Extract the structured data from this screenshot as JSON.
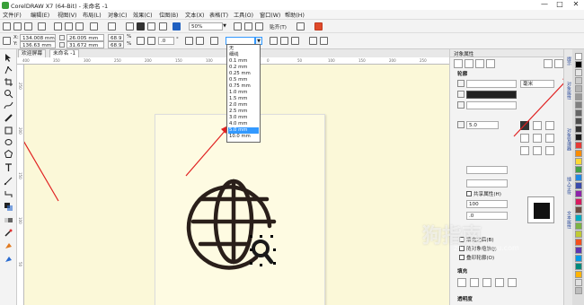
{
  "window": {
    "title": "CorelDRAW X7 (64-Bit) - 未命名 -1",
    "controls": [
      "—",
      "□",
      "✕"
    ]
  },
  "menubar": [
    "文件(F)",
    "编辑(E)",
    "视图(V)",
    "布局(L)",
    "对象(C)",
    "效果(C)",
    "位图(B)",
    "文本(X)",
    "表格(T)",
    "工具(O)",
    "窗口(W)",
    "帮助(H)"
  ],
  "toolbar1": {
    "zoom_value": "50%",
    "snap_label": "贴齐(T)"
  },
  "propertybar": {
    "x_label": "X:",
    "x_value": "134.008 mm",
    "y_label": "Y:",
    "y_value": "136.63 mm",
    "w_value": "26.005 mm",
    "h_value": "31.672 mm",
    "scale_x": "68.9",
    "scale_y": "68.9",
    "pct": "%",
    "rotation": ".0",
    "degree": "°",
    "outline_width": ""
  },
  "tabs": [
    {
      "label": "欢迎屏幕",
      "active": false
    },
    {
      "label": "未命名 -1",
      "active": true
    }
  ],
  "ruler": {
    "h_ticks": [
      "400",
      "350",
      "300",
      "250",
      "200",
      "150",
      "100",
      "50",
      "0",
      "50",
      "100",
      "150",
      "200",
      "250"
    ],
    "v_ticks": [
      "250",
      "200",
      "150",
      "100",
      "50"
    ]
  },
  "outline_dropdown": {
    "options": [
      "无",
      "细线",
      "0.1 mm",
      "0.2 mm",
      "0.25 mm",
      "0.5 mm",
      "0.75 mm",
      "1.0 mm",
      "1.5 mm",
      "2.0 mm",
      "2.5 mm",
      "3.0 mm",
      "4.0 mm",
      "5.0 mm",
      "10.0 mm"
    ],
    "selected": "5.0 mm"
  },
  "panel": {
    "title": "对象属性",
    "section_outline": "轮廓",
    "unit": "毫米",
    "width_value": "5.0",
    "shared_props_label": "共享属性(H)",
    "miter_value": "100",
    "angle_value": ".0",
    "fill_behind": "填充之后(B)",
    "scale_with": "随对象缩放(J)",
    "overprint": "叠印轮廓(O)",
    "section_fill": "填充",
    "section_transparency": "透明度"
  },
  "vertical_tabs": [
    "提示",
    "对象属性",
    "对象管理器",
    "插入字符",
    "文本属性"
  ],
  "palette_colors": [
    "#ffffff",
    "#000000",
    "#e6e6e6",
    "#cccccc",
    "#b3b3b3",
    "#999999",
    "#808080",
    "#666666",
    "#4d4d4d",
    "#333333",
    "#1a1a1a",
    "#e53935",
    "#fb8c00",
    "#fdd835",
    "#43a047",
    "#1e88e5",
    "#3949ab",
    "#8e24aa",
    "#d81b60",
    "#6d4c41",
    "#00acc1",
    "#7cb342",
    "#c0ca33",
    "#f4511e",
    "#5e35b1",
    "#039be5",
    "#00897b",
    "#ffb300",
    "#e0e0e0",
    "#bdbdbd"
  ],
  "watermark": {
    "text": "狗指南",
    "sub": "zhinan.sogou.com"
  },
  "colors": {
    "canvas": "#fbf8d8",
    "page": "#fefbe2",
    "selection": "#3399ff",
    "arrow": "#e02020",
    "globe": "#2a1f1a"
  }
}
